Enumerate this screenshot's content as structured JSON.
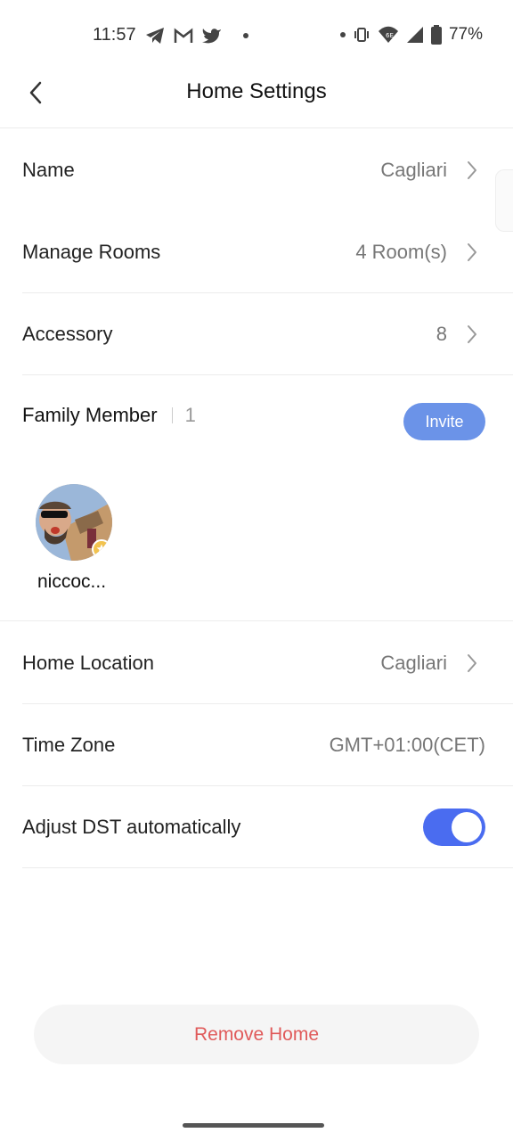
{
  "status_bar": {
    "time": "11:57",
    "battery": "77%",
    "left_icons": [
      "telegram-icon",
      "gmail-icon",
      "twitter-icon",
      "dot-icon"
    ],
    "right_icons": [
      "dot-icon",
      "vibrate-icon",
      "wifi-6e-icon",
      "signal-icon",
      "battery-icon"
    ]
  },
  "header": {
    "title": "Home Settings"
  },
  "rows": {
    "name": {
      "label": "Name",
      "value": "Cagliari"
    },
    "rooms": {
      "label": "Manage Rooms",
      "value": "4 Room(s)"
    },
    "accessory": {
      "label": "Accessory",
      "value": "8"
    },
    "location": {
      "label": "Home Location",
      "value": "Cagliari"
    },
    "timezone": {
      "label": "Time Zone",
      "value": "GMT+01:00(CET)"
    },
    "dst": {
      "label": "Adjust DST automatically",
      "enabled": true
    }
  },
  "family": {
    "title": "Family Member",
    "count": "1",
    "invite_label": "Invite",
    "members": [
      {
        "name": "niccoc..."
      }
    ]
  },
  "remove_label": "Remove Home",
  "colors": {
    "accent": "#4a6cf0",
    "invite": "#6b93e8",
    "danger": "#e05a5a",
    "badge": "#f2c34f"
  }
}
